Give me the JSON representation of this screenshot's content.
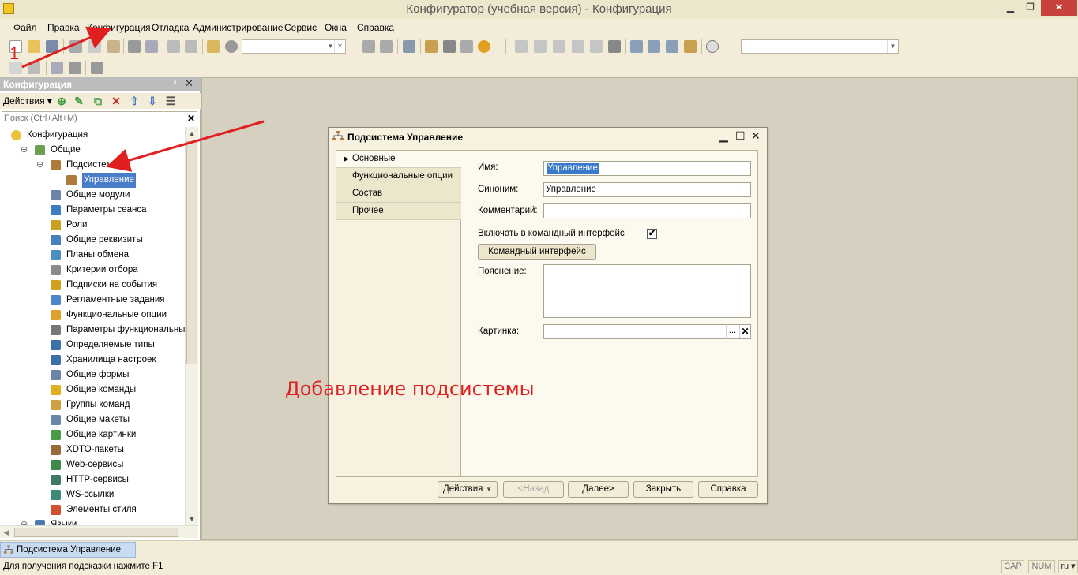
{
  "window": {
    "title": "Конфигуратор (учебная версия) - Конфигурация",
    "controls": {
      "minimize": "▁",
      "maximize": "❐",
      "close": "✕"
    }
  },
  "menu": {
    "file": "Файл",
    "edit": "Правка",
    "config": "Конфигурация",
    "debug": "Отладка",
    "admin": "Администрирование",
    "service": "Сервис",
    "windows": "Окна",
    "help": "Справка"
  },
  "panel": {
    "title": "Конфигурация",
    "pin": "ᵖ",
    "close": "✕",
    "actions_label": "Действия ▾",
    "search_placeholder": "Поиск (Ctrl+Alt+M)",
    "search_clear": "✕"
  },
  "tree": [
    {
      "label": "Конфигурация",
      "icon_color": "#e8c23a",
      "toggle": ""
    },
    {
      "label": "Общие",
      "icon_color": "#6d9e52",
      "toggle": "⊖"
    },
    {
      "label": "Подсистемы",
      "icon_color": "#b07a3c",
      "toggle": "⊖"
    },
    {
      "label": "Управление",
      "icon_color": "#b07a3c",
      "toggle": "",
      "selected": true
    },
    {
      "label": "Общие модули",
      "icon_color": "#6b84a8",
      "toggle": ""
    },
    {
      "label": "Параметры сеанса",
      "icon_color": "#3d7cc2",
      "toggle": ""
    },
    {
      "label": "Роли",
      "icon_color": "#c9a020",
      "toggle": ""
    },
    {
      "label": "Общие реквизиты",
      "icon_color": "#4a7fc0",
      "toggle": ""
    },
    {
      "label": "Планы обмена",
      "icon_color": "#4a8ec2",
      "toggle": ""
    },
    {
      "label": "Критерии отбора",
      "icon_color": "#8a8a8a",
      "toggle": ""
    },
    {
      "label": "Подписки на события",
      "icon_color": "#d0a020",
      "toggle": ""
    },
    {
      "label": "Регламентные задания",
      "icon_color": "#4a86c8",
      "toggle": ""
    },
    {
      "label": "Функциональные опции",
      "icon_color": "#e0a030",
      "toggle": ""
    },
    {
      "label": "Параметры функциональных опций",
      "icon_color": "#777777",
      "toggle": ""
    },
    {
      "label": "Определяемые типы",
      "icon_color": "#3d6fa8",
      "toggle": ""
    },
    {
      "label": "Хранилища настроек",
      "icon_color": "#3d6fa8",
      "toggle": ""
    },
    {
      "label": "Общие формы",
      "icon_color": "#6a85a8",
      "toggle": ""
    },
    {
      "label": "Общие команды",
      "icon_color": "#e0b020",
      "toggle": ""
    },
    {
      "label": "Группы команд",
      "icon_color": "#d0a040",
      "toggle": ""
    },
    {
      "label": "Общие макеты",
      "icon_color": "#6a85a8",
      "toggle": ""
    },
    {
      "label": "Общие картинки",
      "icon_color": "#4a9a4a",
      "toggle": ""
    },
    {
      "label": "XDTO-пакеты",
      "icon_color": "#9a6a3a",
      "toggle": ""
    },
    {
      "label": "Web-сервисы",
      "icon_color": "#3d8a4a",
      "toggle": ""
    },
    {
      "label": "HTTP-сервисы",
      "icon_color": "#3d7a6a",
      "toggle": ""
    },
    {
      "label": "WS-ссылки",
      "icon_color": "#3d8a7a",
      "toggle": ""
    },
    {
      "label": "Элементы стиля",
      "icon_color": "#d05030",
      "toggle": ""
    },
    {
      "label": "Языки",
      "icon_color": "#4a7ab0",
      "toggle": "⊕"
    }
  ],
  "dialog": {
    "title": "Подсистема Управление",
    "controls": {
      "minimize": "▁",
      "maximize": "☐",
      "close": "✕"
    },
    "tabs": [
      {
        "label": "Основные",
        "active": true,
        "marker": "▶"
      },
      {
        "label": "Функциональные опции",
        "active": false,
        "marker": ""
      },
      {
        "label": "Состав",
        "active": false,
        "marker": ""
      },
      {
        "label": "Прочее",
        "active": false,
        "marker": ""
      }
    ],
    "form": {
      "name_label": "Имя:",
      "name_value": "Управление",
      "synonym_label": "Синоним:",
      "synonym_value": "Управление",
      "comment_label": "Комментарий:",
      "comment_value": "",
      "include_label": "Включать в командный интерфейс",
      "include_checked": "✔",
      "cmd_iface_button": "Командный интерфейс",
      "explanation_label": "Пояснение:",
      "picture_label": "Картинка:",
      "picture_dots": "...",
      "picture_clear": "✕"
    },
    "buttons": {
      "actions": "Действия",
      "actions_dd": "▼",
      "back": "<Назад",
      "next": "Далее>",
      "close": "Закрыть",
      "help": "Справка"
    }
  },
  "window_bar": {
    "tab_label": "Подсистема Управление"
  },
  "status": {
    "text": "Для получения подсказки нажмите F1",
    "cap": "CAP",
    "num": "NUM",
    "lang": "ru ▾"
  },
  "annotations": {
    "number": "1",
    "caption": "Добавление подсистемы",
    "color": "#e02020"
  }
}
